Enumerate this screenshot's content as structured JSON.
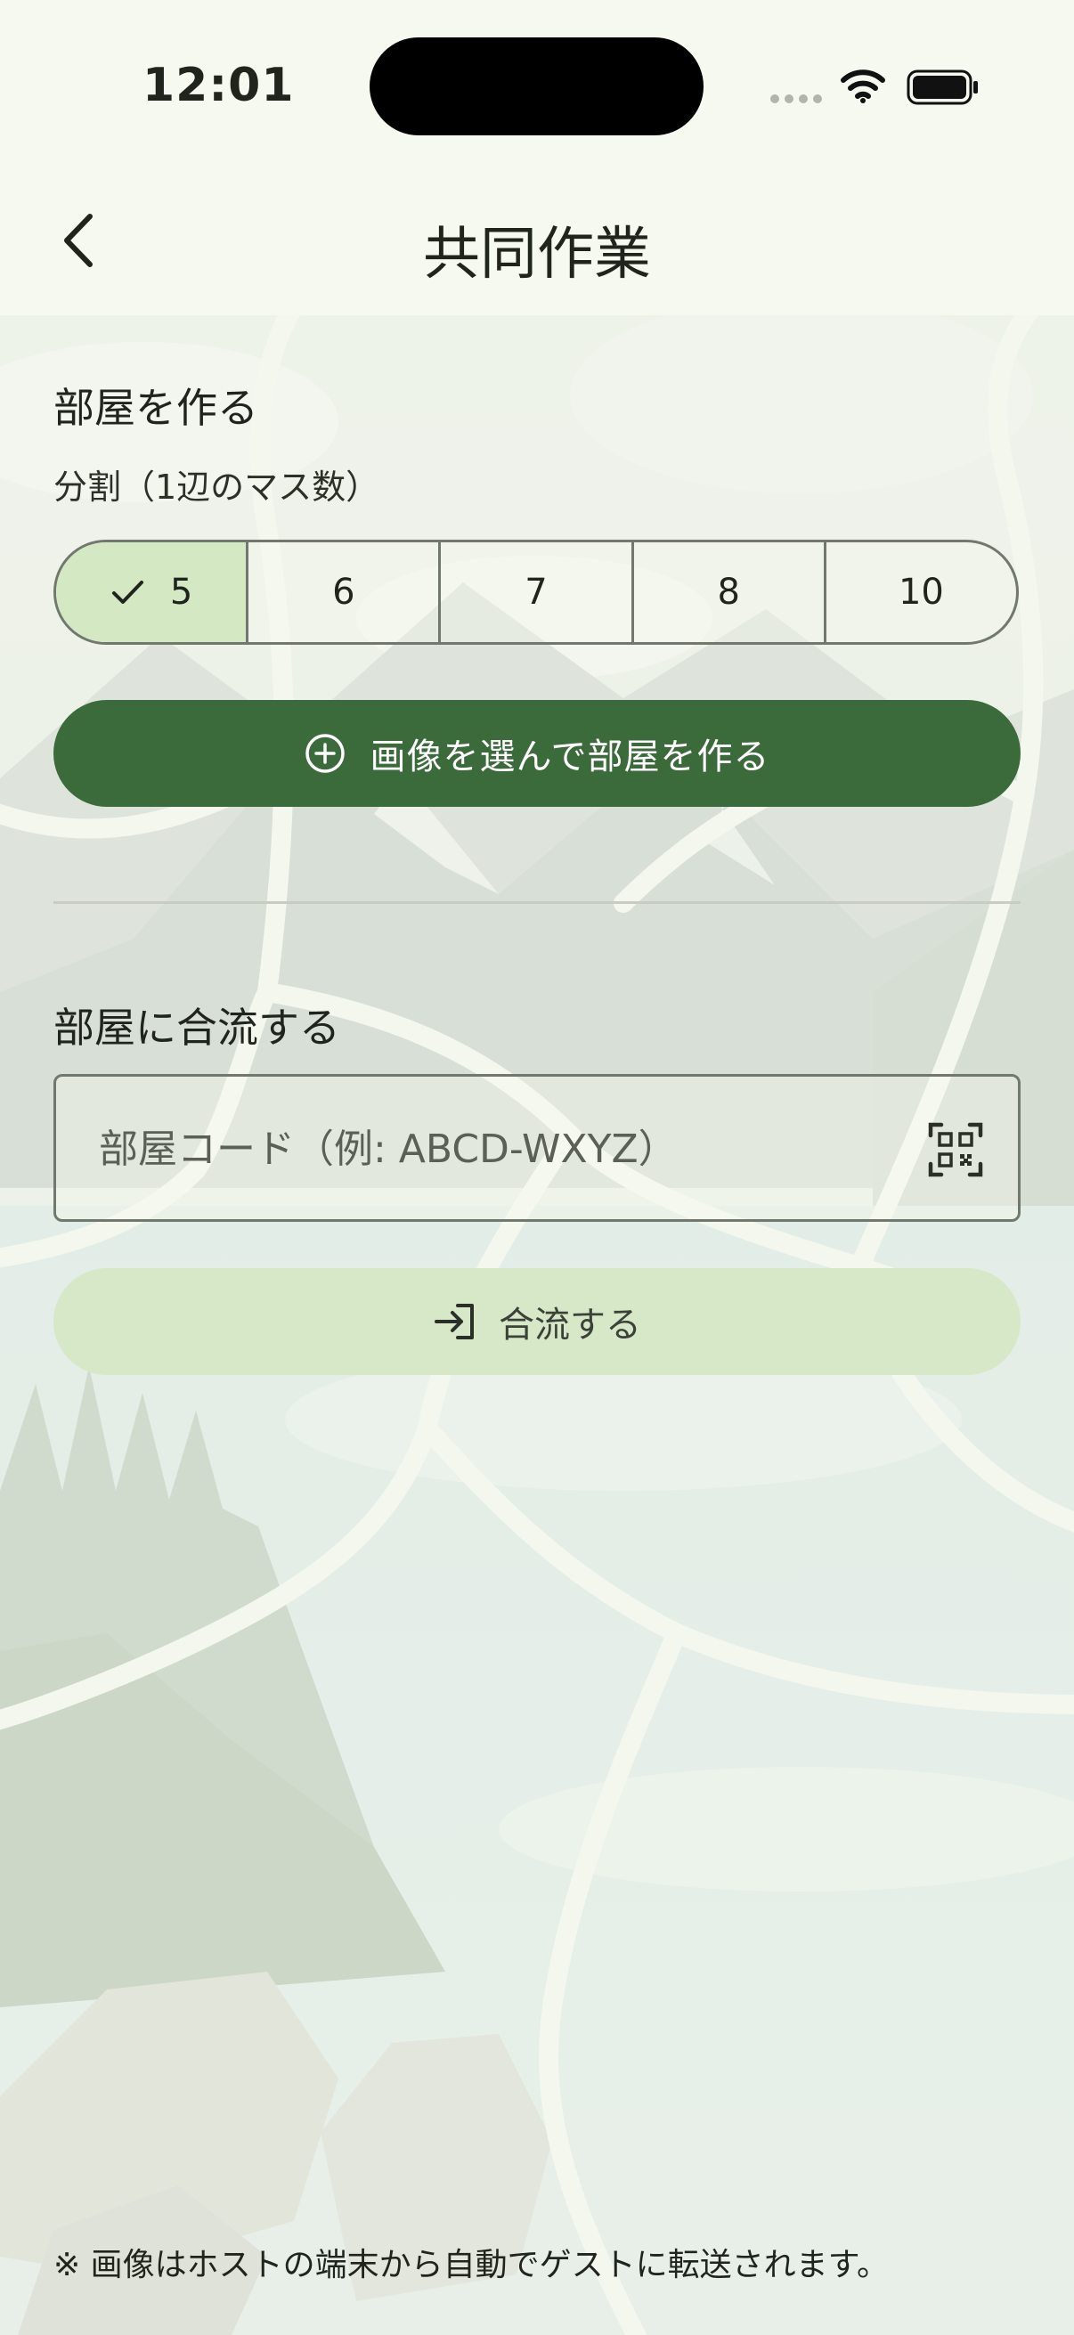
{
  "status_bar": {
    "time": "12:01"
  },
  "nav": {
    "title": "共同作業",
    "back_icon": "chevron-left-icon"
  },
  "create": {
    "heading": "部屋を作る",
    "split_label": "分割（1辺のマス数）",
    "options": [
      "5",
      "6",
      "7",
      "8",
      "10"
    ],
    "selected": "5",
    "button_label": "画像を選んで部屋を作る",
    "button_icon": "plus-circle-icon"
  },
  "join": {
    "heading": "部屋に合流する",
    "code_placeholder": "部屋コード（例: ABCD-WXYZ）",
    "code_value": "",
    "qr_icon": "qr-scan-icon",
    "button_label": "合流する",
    "button_icon": "login-icon"
  },
  "footnote": "※ 画像はホストの端末から自動でゲストに転送されます。",
  "colors": {
    "background": "#f6f9ef",
    "primary": "#3c6b3b",
    "selected_segment": "#d4e8c4",
    "secondary_button": "#d7e8c9",
    "outline": "#71786d"
  }
}
